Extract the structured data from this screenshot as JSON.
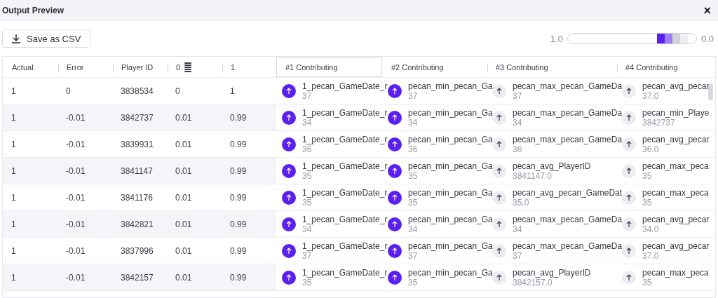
{
  "window": {
    "title": "Output Preview",
    "close": "×"
  },
  "save_button": {
    "label": "Save as CSV"
  },
  "legend": {
    "high": "1.0",
    "low": "0.0"
  },
  "table": {
    "columns": [
      {
        "label": "Actual",
        "selected": false
      },
      {
        "label": "Error",
        "selected": false
      },
      {
        "label": "Player ID",
        "selected": false
      },
      {
        "label": "0",
        "selected": false,
        "icon": true
      },
      {
        "label": "1",
        "selected": false
      },
      {
        "label": "#1 Contributing",
        "selected": true
      },
      {
        "label": "#2 Contributing",
        "selected": false
      },
      {
        "label": "#3 Contributing",
        "selected": false
      },
      {
        "label": "#4 Contributing",
        "selected": false
      }
    ],
    "rows": [
      {
        "cells": [
          "1",
          "0",
          "3838534",
          "0",
          "1"
        ],
        "contributions": [
          {
            "name": "1_pecan_GameDate_r",
            "value": "37",
            "strong": true
          },
          {
            "name": "pecan_min_pecan_Ga",
            "value": "37",
            "strong": true
          },
          {
            "name": "pecan_max_pecan_GameDa",
            "value": "37",
            "strong": false
          },
          {
            "name": "pecan_avg_pecar",
            "value": "37.0",
            "strong": false
          }
        ]
      },
      {
        "cells": [
          "1",
          "-0.01",
          "3842737",
          "0.01",
          "0.99"
        ],
        "contributions": [
          {
            "name": "1_pecan_GameDate_r",
            "value": "34",
            "strong": true
          },
          {
            "name": "pecan_min_pecan_Ga",
            "value": "34",
            "strong": true
          },
          {
            "name": "pecan_max_pecan_GameDa",
            "value": "34",
            "strong": false
          },
          {
            "name": "pecan_min_Playe",
            "value": "3842737",
            "strong": false
          }
        ]
      },
      {
        "cells": [
          "1",
          "-0.01",
          "3839931",
          "0.01",
          "0.99"
        ],
        "contributions": [
          {
            "name": "1_pecan_GameDate_r",
            "value": "36",
            "strong": true
          },
          {
            "name": "pecan_min_pecan_Ga",
            "value": "36",
            "strong": true
          },
          {
            "name": "pecan_max_pecan_GameDa",
            "value": "36",
            "strong": false
          },
          {
            "name": "pecan_avg_pecar",
            "value": "36.0",
            "strong": false
          }
        ]
      },
      {
        "cells": [
          "1",
          "-0.01",
          "3841147",
          "0.01",
          "0.99"
        ],
        "contributions": [
          {
            "name": "1_pecan_GameDate_r",
            "value": "35",
            "strong": true
          },
          {
            "name": "pecan_min_pecan_Ga",
            "value": "35",
            "strong": true
          },
          {
            "name": "pecan_avg_PlayerID",
            "value": "3841147.0",
            "strong": false
          },
          {
            "name": "pecan_max_peca",
            "value": "35",
            "strong": false
          }
        ]
      },
      {
        "cells": [
          "1",
          "-0.01",
          "3841176",
          "0.01",
          "0.99"
        ],
        "contributions": [
          {
            "name": "1_pecan_GameDate_r",
            "value": "35",
            "strong": true
          },
          {
            "name": "pecan_min_pecan_Ga",
            "value": "35",
            "strong": true
          },
          {
            "name": "pecan_avg_pecan_GameDat",
            "value": "35.0",
            "strong": false
          },
          {
            "name": "pecan_max_peca",
            "value": "35",
            "strong": false
          }
        ]
      },
      {
        "cells": [
          "1",
          "-0.01",
          "3842821",
          "0.01",
          "0.99"
        ],
        "contributions": [
          {
            "name": "1_pecan_GameDate_r",
            "value": "34",
            "strong": true
          },
          {
            "name": "pecan_min_pecan_Ga",
            "value": "34",
            "strong": true
          },
          {
            "name": "pecan_max_pecan_GameDa",
            "value": "34",
            "strong": false
          },
          {
            "name": "pecan_avg_pecar",
            "value": "34.0",
            "strong": false
          }
        ]
      },
      {
        "cells": [
          "1",
          "-0.01",
          "3837996",
          "0.01",
          "0.99"
        ],
        "contributions": [
          {
            "name": "1_pecan_GameDate_r",
            "value": "37",
            "strong": true
          },
          {
            "name": "pecan_min_pecan_Ga",
            "value": "37",
            "strong": true
          },
          {
            "name": "pecan_max_pecan_GameDa",
            "value": "37",
            "strong": false
          },
          {
            "name": "pecan_avg_pecar",
            "value": "37.0",
            "strong": false
          }
        ]
      },
      {
        "cells": [
          "1",
          "-0.01",
          "3842157",
          "0.01",
          "0.99"
        ],
        "contributions": [
          {
            "name": "1_pecan_GameDate_r",
            "value": "35",
            "strong": true
          },
          {
            "name": "pecan_min_pecan_Ga",
            "value": "35",
            "strong": true
          },
          {
            "name": "pecan_avg_PlayerID",
            "value": "3842157.0",
            "strong": false
          },
          {
            "name": "pecan_max_peca",
            "value": "35",
            "strong": false
          }
        ]
      }
    ]
  }
}
